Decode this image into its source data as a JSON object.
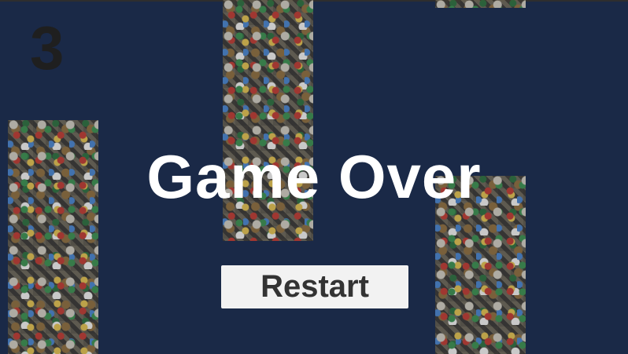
{
  "hud": {
    "score": "3"
  },
  "overlay": {
    "title": "Game Over",
    "restart_label": "Restart"
  },
  "colors": {
    "background": "#1a2947",
    "title_text": "#ffffff",
    "button_background": "#f2f2f2",
    "button_text": "#333333",
    "score_text": "#1f1f1f"
  },
  "obstacles": {
    "texture": "trash-pile",
    "count": 4
  }
}
